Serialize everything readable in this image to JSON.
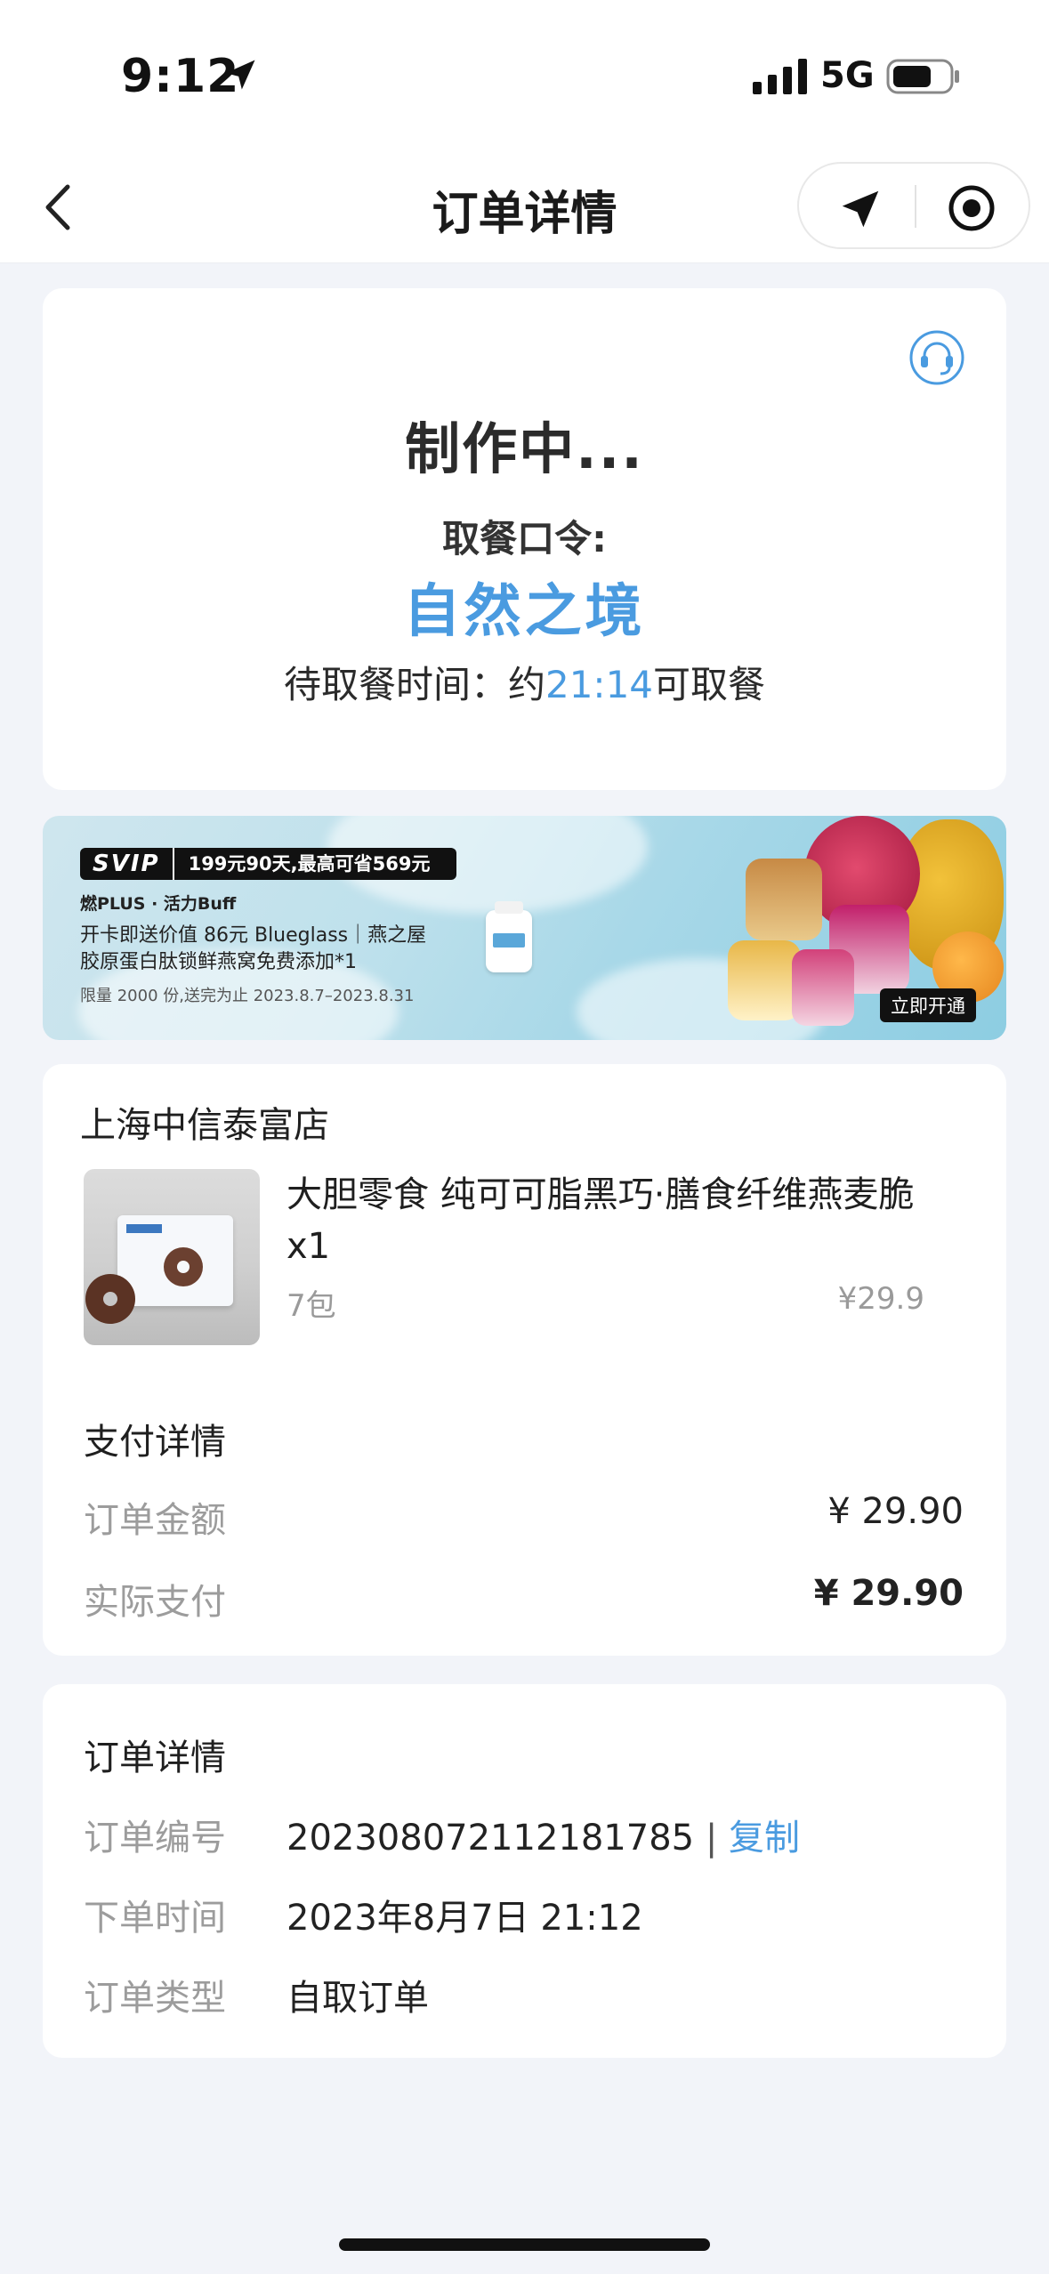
{
  "status_bar": {
    "time": "9:12",
    "network": "5G"
  },
  "nav": {
    "title": "订单详情"
  },
  "order_status": {
    "status": "制作中...",
    "pickup_code_label": "取餐口令:",
    "pickup_code": "自然之境",
    "pickup_time_prefix": "待取餐时间：约",
    "pickup_time": "21:14",
    "pickup_time_suffix": "可取餐"
  },
  "banner": {
    "badge": "SVIP",
    "offer": "199元90天,最高可省569元",
    "brand": "燃PLUS · 活力Buff",
    "line1": "开卡即送价值 86元 Blueglass｜燕之屋",
    "line2": "胶原蛋白肽锁鲜燕窝免费添加*1",
    "limit": "限量 2000 份,送完为止 2023.8.7–2023.8.31",
    "cta": "立即开通"
  },
  "store": {
    "name": "上海中信泰富店",
    "product": {
      "name": "大胆零食 纯可可脂黑巧·膳食纤维燕麦脆 x1",
      "spec": "7包",
      "price": "¥29.9"
    }
  },
  "payment": {
    "title": "支付详情",
    "order_amount_label": "订单金额",
    "order_amount": "¥ 29.90",
    "actual_paid_label": "实际支付",
    "actual_paid": "¥ 29.90"
  },
  "details": {
    "title": "订单详情",
    "order_no_label": "订单编号",
    "order_no": "202308072112181785",
    "separator": "|",
    "copy_label": "复制",
    "order_time_label": "下单时间",
    "order_time": "2023年8月7日 21:12",
    "order_type_label": "订单类型",
    "order_type": "自取订单"
  },
  "colors": {
    "accent": "#4a9be0",
    "background": "#f2f4f9",
    "muted": "#9c9c9c"
  },
  "icons": [
    "location-arrow-icon",
    "signal-icon",
    "battery-icon",
    "back-chevron-icon",
    "share-arrow-icon",
    "close-target-icon",
    "headset-icon"
  ]
}
